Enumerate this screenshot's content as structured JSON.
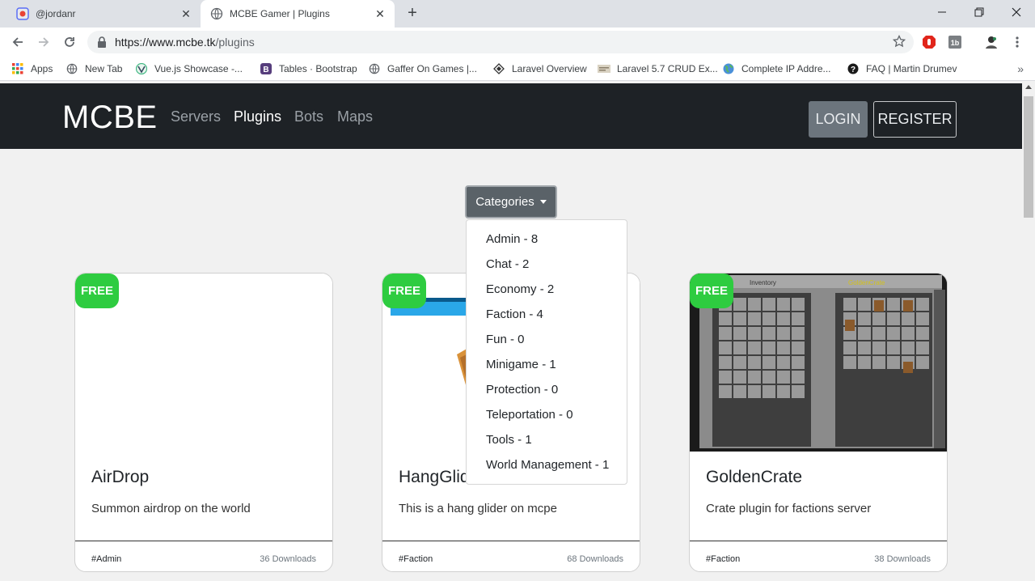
{
  "browser": {
    "tabs": [
      {
        "title": "@jordanr",
        "active": false
      },
      {
        "title": "MCBE Gamer | Plugins",
        "active": true
      }
    ],
    "url_host": "https://www.mcbe.tk",
    "url_path": "/plugins",
    "bookmarks": [
      {
        "label": "Apps",
        "icon": "apps-grid-icon"
      },
      {
        "label": "New Tab",
        "icon": "globe-icon"
      },
      {
        "label": "Vue.js Showcase -...",
        "icon": "vue-icon"
      },
      {
        "label": "Tables · Bootstrap",
        "icon": "bootstrap-icon"
      },
      {
        "label": "Gaffer On Games |...",
        "icon": "globe-icon"
      },
      {
        "label": "Laravel Overview",
        "icon": "laravel-icon"
      },
      {
        "label": "Laravel 5.7 CRUD Ex...",
        "icon": "page-icon"
      },
      {
        "label": "Complete IP Addre...",
        "icon": "earth-icon"
      },
      {
        "label": "FAQ | Martin Drumev",
        "icon": "question-icon"
      }
    ]
  },
  "site": {
    "brand": "MCBE",
    "nav": [
      "Servers",
      "Plugins",
      "Bots",
      "Maps"
    ],
    "active_nav": "Plugins",
    "login": "LOGIN",
    "register": "REGISTER"
  },
  "categories": {
    "button": "Categories",
    "items": [
      "Admin - 8",
      "Chat - 2",
      "Economy - 2",
      "Faction - 4",
      "Fun - 0",
      "Minigame - 1",
      "Protection - 0",
      "Teleportation - 0",
      "Tools - 1",
      "World Management - 1"
    ]
  },
  "cards": [
    {
      "badge": "FREE",
      "title": "AirDrop",
      "desc": "Summon airdrop on the world",
      "tag": "#Admin",
      "downloads": "36 Downloads"
    },
    {
      "badge": "FREE",
      "title": "HangGlider",
      "desc": "This is a hang glider on mcpe",
      "tag": "#Faction",
      "downloads": "68 Downloads"
    },
    {
      "badge": "FREE",
      "title": "GoldenCrate",
      "desc": "Crate plugin for factions server",
      "tag": "#Faction",
      "downloads": "38 Downloads"
    }
  ],
  "goldencrate_image": {
    "inventory_label": "Inventory",
    "crate_label": "GoldenCrate"
  },
  "colors": {
    "nav_bg": "#1e2226",
    "badge": "#2ecc40",
    "page_bg": "#f1f1f1"
  }
}
